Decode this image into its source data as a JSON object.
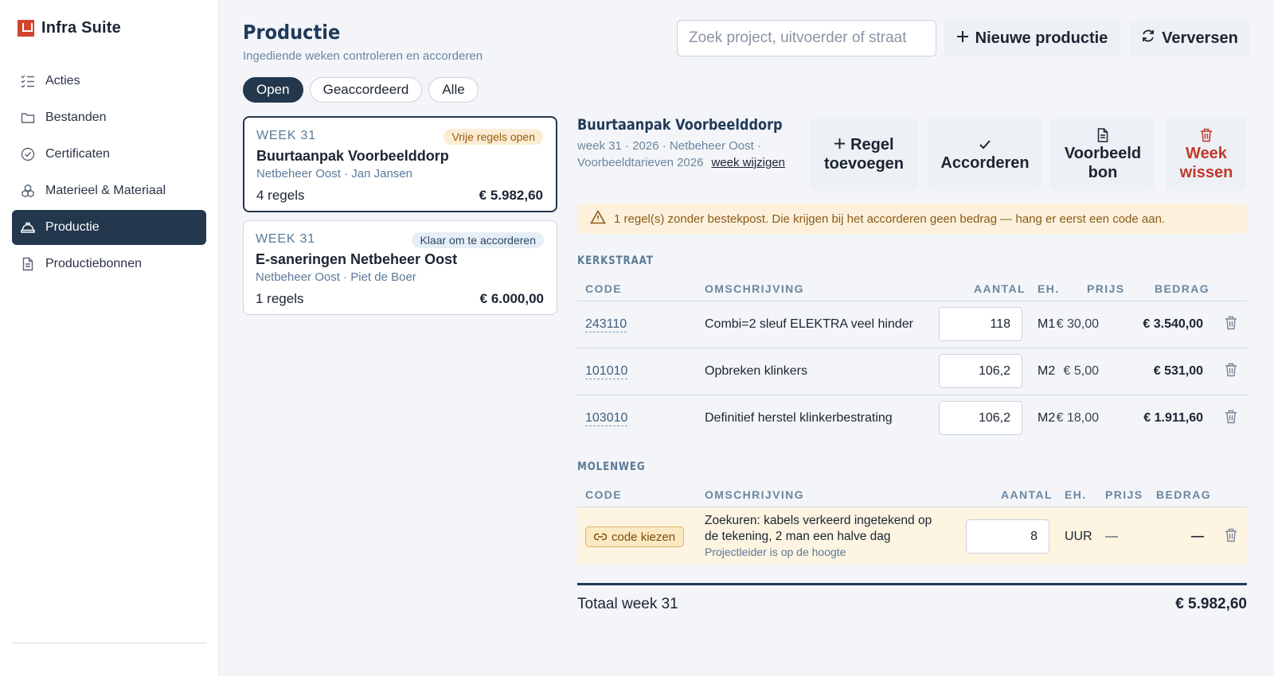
{
  "brand": {
    "name": "Infra Suite",
    "color": "#d2452c"
  },
  "nav": {
    "items": [
      {
        "label": "Acties",
        "icon": "checklist-icon"
      },
      {
        "label": "Bestanden",
        "icon": "folder-icon"
      },
      {
        "label": "Certificaten",
        "icon": "badge-check-icon"
      },
      {
        "label": "Materieel & Materiaal",
        "icon": "boxes-icon"
      },
      {
        "label": "Productie",
        "icon": "hardhat-icon",
        "active": true
      },
      {
        "label": "Productiebonnen",
        "icon": "document-icon"
      }
    ]
  },
  "header": {
    "title": "Productie",
    "subtitle": "Ingediende weken controleren en accorderen",
    "search_placeholder": "Zoek project, uitvoerder of straat",
    "new_label": "Nieuwe productie",
    "refresh_label": "Verversen"
  },
  "filters": [
    "Open",
    "Geaccordeerd",
    "Alle"
  ],
  "weeks": [
    {
      "week": "WEEK 31",
      "badge": "Vrije regels open",
      "title": "Buurtaanpak Voorbeelddorp",
      "client": "Netbeheer Oost",
      "person": "Jan Jansen",
      "rows": "4 regels",
      "sum": "€ 5.982,60"
    },
    {
      "week": "WEEK 31",
      "badge": "Klaar om te accorderen",
      "title": "E-saneringen Netbeheer Oost",
      "client": "Netbeheer Oost",
      "person": "Piet de Boer",
      "rows": "1 regels",
      "sum": "€ 6.000,00"
    }
  ],
  "detail": {
    "title": "Buurtaanpak Voorbeelddorp",
    "meta": "week 31 · 2026 · Netbeheer Oost · Voorbeeldtarieven 2026",
    "change_week": "week wijzigen",
    "actions": {
      "add_1": "Regel",
      "add_2": "toevoegen",
      "approve": "Accorderen",
      "preview_1": "Voorbeeld",
      "preview_2": "bon",
      "delete_1": "Week",
      "delete_2": "wissen"
    },
    "warning": "1 regel(s) zonder bestekpost. Die krijgen bij het accorderen geen bedrag — hang er eerst een code aan.",
    "columns": {
      "code": "CODE",
      "desc": "OMSCHRIJVING",
      "qty": "AANTAL",
      "unit": "EH.",
      "price": "PRIJS",
      "amount": "BEDRAG"
    },
    "sections": [
      {
        "name": "KERKSTRAAT",
        "rows": [
          {
            "code": "243110",
            "desc": "Combi=2 sleuf ELEKTRA veel hinder",
            "qty": "118",
            "unit": "M1",
            "price": "€ 30,00",
            "amount": "€ 3.540,00"
          },
          {
            "code": "101010",
            "desc": "Opbreken klinkers",
            "qty": "106,2",
            "unit": "M2",
            "price": "€ 5,00",
            "amount": "€ 531,00"
          },
          {
            "code": "103010",
            "desc": "Definitief herstel klinkerbestrating",
            "qty": "106,2",
            "unit": "M2",
            "price": "€ 18,00",
            "amount": "€ 1.911,60"
          }
        ]
      },
      {
        "name": "MOLENWEG",
        "rows": [
          {
            "code_pick": "code kiezen",
            "desc_1": "Zoekuren: kabels verkeerd ingetekend op",
            "desc_2": "de tekening, 2 man een halve dag",
            "note": "Projectleider is op de hoogte",
            "qty": "8",
            "unit": "UUR",
            "price": "—",
            "amount": "—"
          }
        ]
      }
    ],
    "total_label": "Totaal week 31",
    "total_value": "€ 5.982,60"
  }
}
